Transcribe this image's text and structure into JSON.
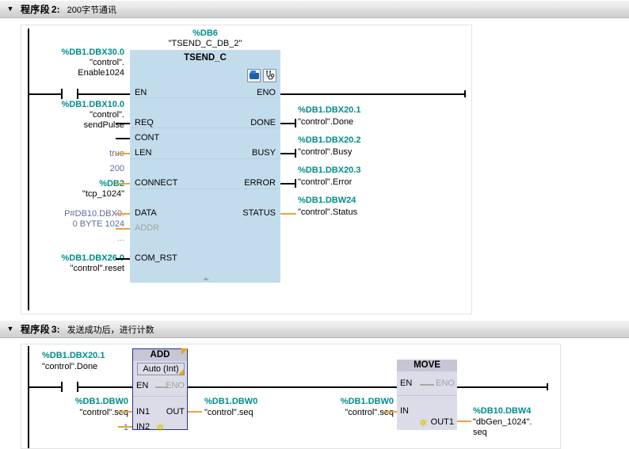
{
  "networks": [
    {
      "collapse_icon": "chevron-down-icon",
      "title": "程序段",
      "number": "2",
      "colon": ":",
      "comment": "200字节通讯",
      "block": {
        "instance_db_addr": "%DB6",
        "instance_db_name": "\"TSEND_C_DB_2\"",
        "name": "TSEND_C",
        "icons": [
          "open-block-icon",
          "diagnostics-icon"
        ],
        "inputs": [
          {
            "pin": "EN",
            "addr": "%DB1.DBX30.0",
            "sym_line1": "\"control\".",
            "sym_line2": "Enable1024"
          },
          {
            "pin": "REQ",
            "addr": "%DB1.DBX10.0",
            "sym_line1": "\"control\".",
            "sym_line2": "sendPulse"
          },
          {
            "pin": "CONT",
            "literal": "true"
          },
          {
            "pin": "LEN",
            "literal": "200"
          },
          {
            "pin": "CONNECT",
            "addr": "%DB2",
            "sym_line1": "\"tcp_1024\""
          },
          {
            "pin": "DATA",
            "lit_line1": "P#DB10.DBX0.",
            "lit_line2": "0 BYTE 1024"
          },
          {
            "pin": "ADDR",
            "literal": "...",
            "disabled": true
          },
          {
            "pin": "COM_RST",
            "addr": "%DB1.DBX26.0",
            "sym_line1": "\"control\".reset"
          }
        ],
        "outputs": [
          {
            "pin": "ENO"
          },
          {
            "pin": "DONE",
            "addr": "%DB1.DBX20.1",
            "sym": "\"control\".Done"
          },
          {
            "pin": "BUSY",
            "addr": "%DB1.DBX20.2",
            "sym": "\"control\".Busy"
          },
          {
            "pin": "ERROR",
            "addr": "%DB1.DBX20.3",
            "sym": "\"control\".Error"
          },
          {
            "pin": "STATUS",
            "addr": "%DB1.DBW24",
            "sym": "\"control\".Status"
          }
        ]
      }
    },
    {
      "collapse_icon": "chevron-down-icon",
      "title": "程序段",
      "number": "3",
      "colon": ":",
      "comment": "发送成功后，进行计数",
      "contact": {
        "addr": "%DB1.DBX20.1",
        "sym": "\"control\".Done"
      },
      "add_block": {
        "name": "ADD",
        "mode": "Auto (Int)",
        "pin_en": "EN",
        "pin_eno": "ENO",
        "in1": {
          "pin": "IN1",
          "addr": "%DB1.DBW0",
          "sym": "\"control\".seq"
        },
        "in2": {
          "pin": "IN2",
          "literal": "1",
          "icon": "add-parameter-star-icon"
        },
        "out": {
          "pin": "OUT",
          "addr": "%DB1.DBW0",
          "sym": "\"control\".seq"
        }
      },
      "move_block": {
        "name": "MOVE",
        "pin_en": "EN",
        "pin_eno": "ENO",
        "in": {
          "pin": "IN",
          "addr": "%DB1.DBW0",
          "sym": "\"control\".seq"
        },
        "out1": {
          "pin": "OUT1",
          "addr": "%DB10.DBW4",
          "sym_line1": "\"dbGen_1024\".",
          "sym_line2": "seq",
          "icon": "add-parameter-star-icon"
        }
      }
    }
  ],
  "colors": {
    "address_teal": "#008c8c",
    "literal_blue": "#5c6b9e",
    "block_fill_blue": "#c3dcec",
    "block_fill_gray": "#dcdce8",
    "block_border_selected": "#26348c",
    "wire_orange": "#e8a33d"
  }
}
